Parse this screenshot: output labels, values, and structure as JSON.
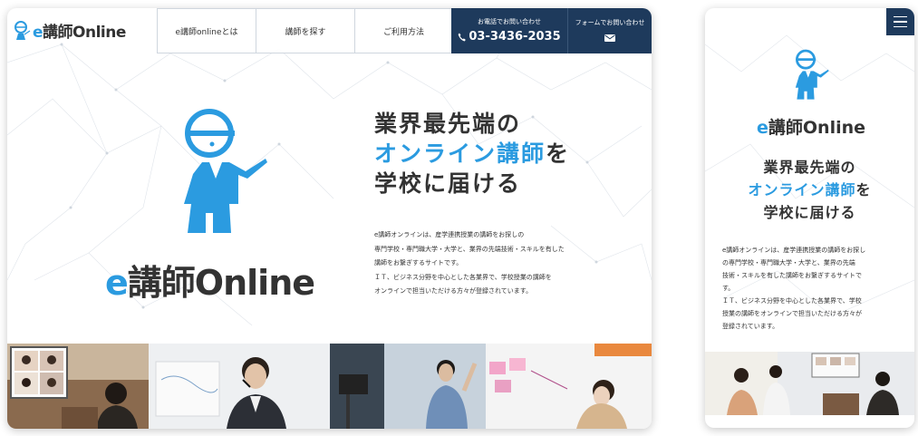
{
  "desktop": {
    "logo": {
      "prefix": "e",
      "word": "講師Online"
    },
    "nav": [
      {
        "label": "e講師onlineとは"
      },
      {
        "label": "講師を探す"
      },
      {
        "label": "ご利用方法"
      }
    ],
    "tel": {
      "caption": "お電話でお問い合わせ",
      "number": "03-3436-2035"
    },
    "form": {
      "caption": "フォームでお問い合わせ"
    },
    "hero_logo": {
      "prefix": "e",
      "word": "講師Online"
    },
    "catch": {
      "line1": "業界最先端の",
      "line2_highlight": "オンライン講師",
      "line2_rest": "を",
      "line3": "学校に届ける"
    },
    "lead": [
      "e講師オンラインは、産学連携授業の講師をお探しの",
      "専門学校・専門職大学・大学と、業界の先端技術・スキルを有した",
      "講師をお繋ぎするサイトです。",
      "ＩＴ、ビジネス分野を中心とした各業界で、学校授業の講師を",
      "オンラインで担当いただける方々が登録されています。"
    ]
  },
  "mobile": {
    "logo": {
      "prefix": "e",
      "word": "講師Online"
    },
    "catch": {
      "line1": "業界最先端の",
      "line2_highlight": "オンライン講師",
      "line2_rest": "を",
      "line3": "学校に届ける"
    },
    "lead": [
      "e講師オンラインは、産学連携授業の講師をお探し",
      "の専門学校・専門職大学・大学と、業界の先端",
      "技術・スキルを有した講師をお繋ぎするサイトで",
      "す。",
      "ＩＴ、ビジネス分野を中心とした各業界で、学校",
      "授業の講師をオンラインで担当いただける方々が",
      "登録されています。"
    ]
  },
  "colors": {
    "brand_blue": "#2b9be0",
    "navy": "#1e3a5c",
    "text": "#333333"
  },
  "icons": [
    "mascot-icon",
    "phone-icon",
    "mail-icon",
    "hamburger-menu-icon"
  ]
}
